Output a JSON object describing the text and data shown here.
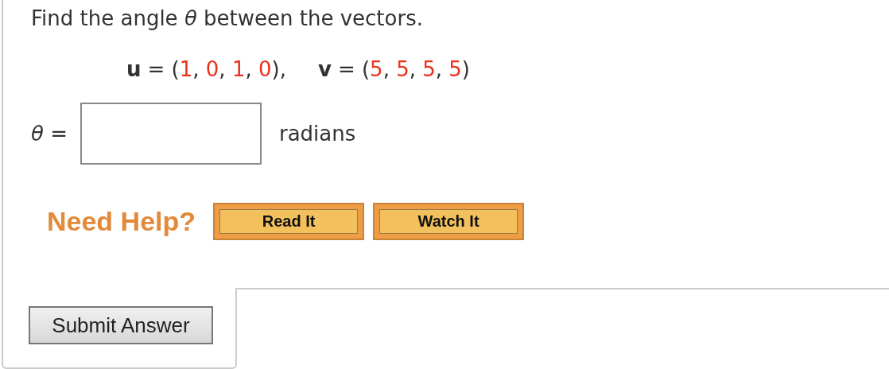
{
  "question": "Find the angle *θ* between the vectors.",
  "equation": [
    {
      "kind": "var",
      "text": "u"
    },
    {
      "kind": "op",
      "text": "= ("
    },
    {
      "kind": "num",
      "text": "1"
    },
    {
      "kind": "op",
      "text": ", "
    },
    {
      "kind": "num",
      "text": "0"
    },
    {
      "kind": "op",
      "text": ", "
    },
    {
      "kind": "num",
      "text": "1"
    },
    {
      "kind": "op",
      "text": ", "
    },
    {
      "kind": "num",
      "text": "0"
    },
    {
      "kind": "op",
      "text": "),"
    },
    {
      "kind": "gap"
    },
    {
      "kind": "var",
      "text": "v"
    },
    {
      "kind": "op",
      "text": "= ("
    },
    {
      "kind": "num",
      "text": "5"
    },
    {
      "kind": "op",
      "text": ", "
    },
    {
      "kind": "num",
      "text": "5"
    },
    {
      "kind": "op",
      "text": ", "
    },
    {
      "kind": "num",
      "text": "5"
    },
    {
      "kind": "op",
      "text": ", "
    },
    {
      "kind": "num",
      "text": "5"
    },
    {
      "kind": "op",
      "text": ")"
    }
  ],
  "answer": {
    "label": "*θ* =",
    "unit": "radians"
  },
  "help": {
    "label": "Need Help?",
    "buttons": [
      "Read It",
      "Watch It"
    ]
  },
  "submit": "Submit Answer"
}
